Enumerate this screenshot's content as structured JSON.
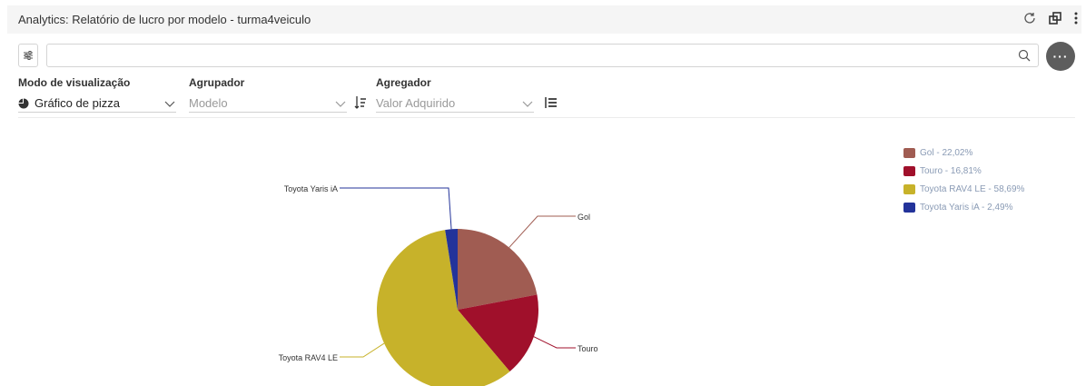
{
  "window": {
    "title": "Analytics: Relatório de lucro por modelo - turma4veiculo"
  },
  "search": {
    "value": "",
    "placeholder": ""
  },
  "more_button": {
    "label": "···"
  },
  "controls": {
    "mode": {
      "label": "Modo de visualização",
      "value": "Gráfico de pizza"
    },
    "grouper": {
      "label": "Agrupador",
      "value": "Modelo"
    },
    "aggregator": {
      "label": "Agregador",
      "value": "Valor Adquirido"
    }
  },
  "legend": [
    {
      "text": "Gol - 22,02%",
      "color": "#a05c52"
    },
    {
      "text": "Touro - 16,81%",
      "color": "#a0102b"
    },
    {
      "text": "Toyota RAV4 LE - 58,69%",
      "color": "#c7b22a"
    },
    {
      "text": "Toyota Yaris iA - 2,49%",
      "color": "#23339a"
    }
  ],
  "chart_data": {
    "type": "pie",
    "categories": [
      "Gol",
      "Touro",
      "Toyota RAV4 LE",
      "Toyota Yaris iA"
    ],
    "values": [
      22.02,
      16.81,
      58.69,
      2.49
    ],
    "colors": [
      "#a05c52",
      "#a0102b",
      "#c7b22a",
      "#23339a"
    ],
    "legend_position": "top-right"
  }
}
